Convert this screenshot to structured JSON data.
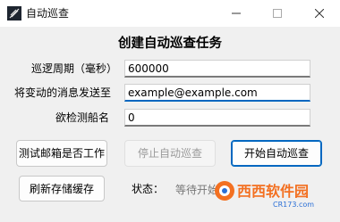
{
  "window": {
    "title": "自动巡查"
  },
  "heading": "创建自动巡查任务",
  "form": {
    "interval_label": "巡逻周期（毫秒）",
    "interval_value": "600000",
    "email_label": "将变动的消息发送至",
    "email_value": "example@example.com",
    "ship_label": "欲检测船名",
    "ship_value": "0"
  },
  "buttons": {
    "test_email": "测试邮箱是否工作",
    "stop": "停止自动巡查",
    "start": "开始自动巡查",
    "refresh": "刷新存储缓存"
  },
  "status": {
    "label": "状态：",
    "value": "等待开始"
  },
  "watermark": {
    "text": "西西软件园",
    "url": "CR173.com"
  },
  "colors": {
    "accent": "#0067c0",
    "watermark_orange": "#f37021",
    "watermark_blue": "#2a6fd6"
  }
}
